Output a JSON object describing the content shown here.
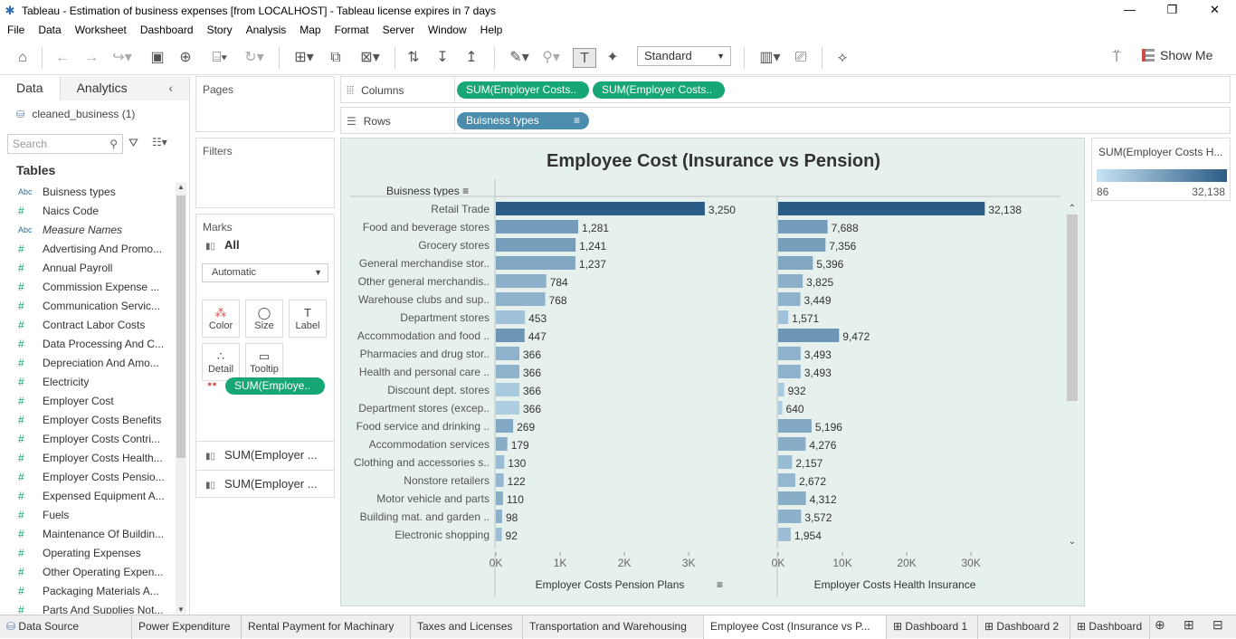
{
  "titlebar": {
    "text": "Tableau - Estimation of business expenses [from LOCALHOST] - Tableau license expires in 7 days"
  },
  "menu": [
    "File",
    "Data",
    "Worksheet",
    "Dashboard",
    "Story",
    "Analysis",
    "Map",
    "Format",
    "Server",
    "Window",
    "Help"
  ],
  "toolbar": {
    "standard": "Standard",
    "show_me": "Show Me"
  },
  "left": {
    "tab_data": "Data",
    "tab_analytics": "Analytics",
    "datasource": "cleaned_business (1)",
    "search_placeholder": "Search",
    "tables_label": "Tables",
    "fields": [
      {
        "type": "Abc",
        "name": "Buisness types"
      },
      {
        "type": "#",
        "name": "Naics Code"
      },
      {
        "type": "Abc",
        "name": "Measure Names",
        "italic": true
      },
      {
        "type": "#",
        "name": "Advertising And Promo..."
      },
      {
        "type": "#",
        "name": "Annual Payroll"
      },
      {
        "type": "#",
        "name": "Commission Expense ..."
      },
      {
        "type": "#",
        "name": "Communication Servic..."
      },
      {
        "type": "#",
        "name": "Contract Labor Costs"
      },
      {
        "type": "#",
        "name": "Data Processing And C..."
      },
      {
        "type": "#",
        "name": "Depreciation And Amo..."
      },
      {
        "type": "#",
        "name": "Electricity"
      },
      {
        "type": "#",
        "name": "Employer Cost"
      },
      {
        "type": "#",
        "name": "Employer Costs Benefits"
      },
      {
        "type": "#",
        "name": "Employer Costs Contri..."
      },
      {
        "type": "#",
        "name": "Employer Costs Health..."
      },
      {
        "type": "#",
        "name": "Employer Costs Pensio..."
      },
      {
        "type": "#",
        "name": "Expensed Equipment A..."
      },
      {
        "type": "#",
        "name": "Fuels"
      },
      {
        "type": "#",
        "name": "Maintenance Of Buildin..."
      },
      {
        "type": "#",
        "name": "Operating Expenses"
      },
      {
        "type": "#",
        "name": "Other Operating Expen..."
      },
      {
        "type": "#",
        "name": "Packaging Materials A..."
      },
      {
        "type": "#",
        "name": "Parts And Supplies Not..."
      }
    ]
  },
  "cards": {
    "pages": "Pages",
    "filters": "Filters",
    "marks": "Marks",
    "all": "All",
    "automatic": "Automatic",
    "color": "Color",
    "size": "Size",
    "label": "Label",
    "detail": "Detail",
    "tooltip": "Tooltip",
    "color_pill": "SUM(Employe..",
    "measure1": "SUM(Employer ...",
    "measure2": "SUM(Employer ..."
  },
  "shelves": {
    "columns_label": "Columns",
    "rows_label": "Rows",
    "col_pill1": "SUM(Employer Costs..",
    "col_pill2": "SUM(Employer Costs..",
    "row_pill": "Buisness types"
  },
  "viz": {
    "title": "Employee Cost (Insurance vs Pension)",
    "row_header": "Buisness types"
  },
  "legend": {
    "title": "SUM(Employer Costs H...",
    "min": "86",
    "max": "32,138"
  },
  "tabs": [
    {
      "label": "Data Source"
    },
    {
      "label": "Power Expenditure"
    },
    {
      "label": "Rental Payment for Machinary"
    },
    {
      "label": "Taxes and Licenses"
    },
    {
      "label": "Transportation and Warehousing"
    },
    {
      "label": "Employee Cost (Insurance vs P...",
      "active": true
    },
    {
      "label": "Dashboard 1"
    },
    {
      "label": "Dashboard 2"
    },
    {
      "label": "Dashboard"
    }
  ],
  "chart_data": {
    "type": "bar",
    "orientation": "horizontal",
    "categories": [
      "Retail Trade",
      "Food and beverage stores",
      "Grocery stores",
      "General merchandise stor..",
      "Other general merchandis..",
      "Warehouse clubs and sup..",
      "Department stores",
      "Accommodation and food ..",
      "Pharmacies and drug stor..",
      "Health and personal care ..",
      "Discount dept. stores",
      "Department stores (excep..",
      "Food service and drinking ..",
      "Accommodation services",
      "Clothing and accessories s..",
      "Nonstore retailers",
      "Motor vehicle and parts",
      "Building mat. and garden ..",
      "Electronic shopping"
    ],
    "series": [
      {
        "name": "Employer Costs Pension Plans",
        "values": [
          3250,
          1281,
          1241,
          1237,
          784,
          768,
          453,
          447,
          366,
          366,
          366,
          366,
          269,
          179,
          130,
          122,
          110,
          98,
          92
        ],
        "labels": [
          "3,250",
          "1,281",
          "1,241",
          "1,237",
          "784",
          "768",
          "453",
          "447",
          "366",
          "366",
          "366",
          "366",
          "269",
          "179",
          "130",
          "122",
          "110",
          "98",
          "92"
        ],
        "ticks": [
          "0K",
          "1K",
          "2K",
          "3K"
        ],
        "xlim": [
          0,
          3800
        ]
      },
      {
        "name": "Employer Costs Health Insurance",
        "values": [
          32138,
          7688,
          7356,
          5396,
          3825,
          3449,
          1571,
          9472,
          3493,
          3493,
          932,
          640,
          5196,
          4276,
          2157,
          2672,
          4312,
          3572,
          1954
        ],
        "labels": [
          "32,138",
          "7,688",
          "7,356",
          "5,396",
          "3,825",
          "3,449",
          "1,571",
          "9,472",
          "3,493",
          "3,493",
          "932",
          "640",
          "5,196",
          "4,276",
          "2,157",
          "2,672",
          "4,312",
          "3,572",
          "1,954"
        ],
        "ticks": [
          "0K",
          "10K",
          "20K",
          "30K"
        ],
        "xlim": [
          0,
          38000
        ]
      }
    ],
    "color_measure": "Employer Costs Health Insurance",
    "color_range": [
      "#c7e3f3",
      "#2b5c86"
    ],
    "color_domain": [
      86,
      32138
    ]
  }
}
